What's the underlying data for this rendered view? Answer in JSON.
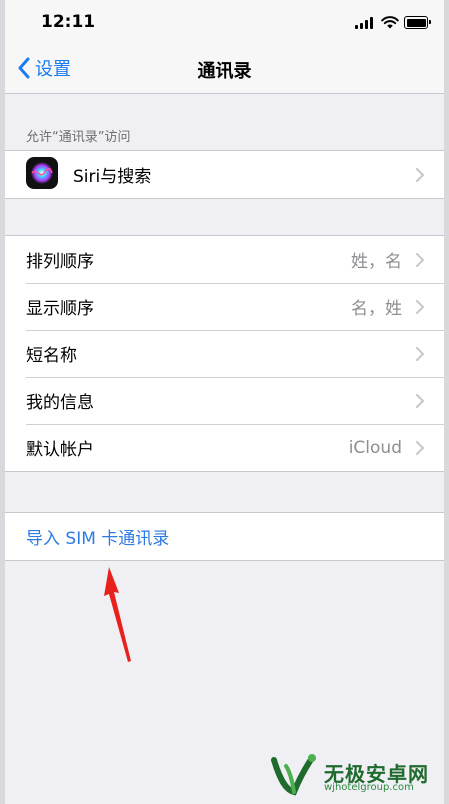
{
  "status_bar": {
    "time": "12:11"
  },
  "nav": {
    "back_label": "设置",
    "title": "通讯录"
  },
  "section_allow": {
    "header": "允许“通讯录”访问"
  },
  "siri_row": {
    "label": "Siri与搜索"
  },
  "settings_rows": [
    {
      "label": "排列顺序",
      "value": "姓，名"
    },
    {
      "label": "显示顺序",
      "value": "名，姓"
    },
    {
      "label": "短名称",
      "value": ""
    },
    {
      "label": "我的信息",
      "value": ""
    },
    {
      "label": "默认帐户",
      "value": "iCloud"
    }
  ],
  "import_sim": {
    "label": "导入 SIM 卡通讯录"
  },
  "watermark": {
    "text": "无极安卓网",
    "url": "wjhotelgroup.com"
  },
  "colors": {
    "accent": "#1a7cf4",
    "link": "#2c7be5",
    "arrow": "#e8211d",
    "background": "#efeff4"
  },
  "icons": [
    "chevron-left-icon",
    "chevron-right-icon",
    "siri-icon",
    "wifi-icon",
    "battery-icon",
    "signal-icon"
  ]
}
